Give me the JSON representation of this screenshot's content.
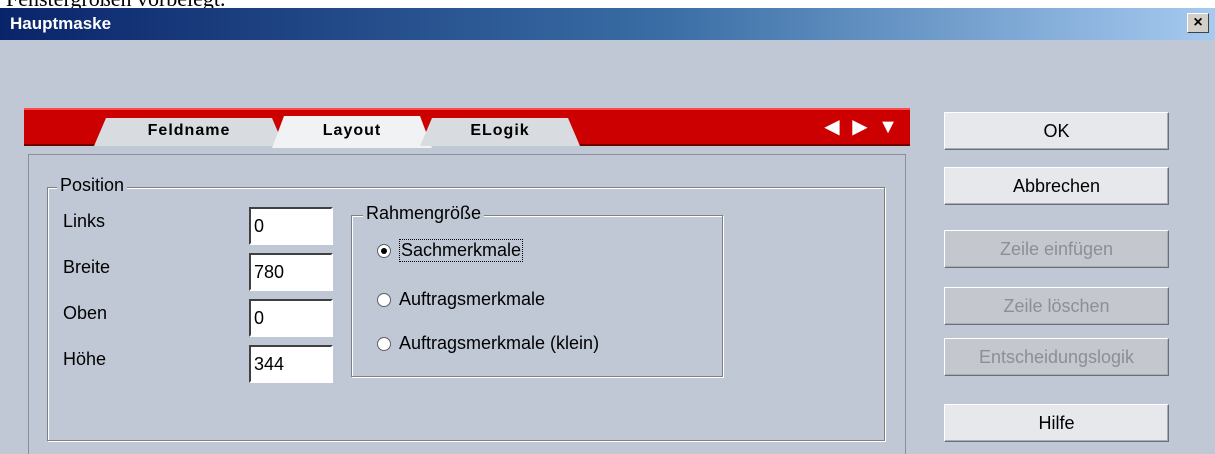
{
  "above_text": "Fenstergrößen vorbelegt.",
  "window": {
    "title": "Hauptmaske",
    "close_glyph": "×"
  },
  "tabs": [
    {
      "label": "Feldname",
      "active": false
    },
    {
      "label": "Layout",
      "active": true
    },
    {
      "label": "ELogik",
      "active": false
    }
  ],
  "nav": {
    "prev": "◀",
    "next": "▶",
    "menu": "▼"
  },
  "position": {
    "group_label": "Position",
    "fields": [
      {
        "label": "Links",
        "value": "0"
      },
      {
        "label": "Breite",
        "value": "780"
      },
      {
        "label": "Oben",
        "value": "0"
      },
      {
        "label": "Höhe",
        "value": "344"
      }
    ]
  },
  "rahmen": {
    "group_label": "Rahmengröße",
    "options": [
      {
        "label": "Sachmerkmale",
        "selected": true
      },
      {
        "label": "Auftragsmerkmale",
        "selected": false
      },
      {
        "label": "Auftragsmerkmale (klein)",
        "selected": false
      }
    ]
  },
  "buttons": {
    "ok": "OK",
    "abbrechen": "Abbrechen",
    "zeile_einfuegen": "Zeile einfügen",
    "zeile_loeschen": "Zeile löschen",
    "entscheidungslogik": "Entscheidungslogik",
    "hilfe": "Hilfe"
  },
  "colors": {
    "tab_bar": "#cc0000",
    "window_bg": "#c0c8d5",
    "titlebar_start": "#0a246a",
    "titlebar_end": "#a6caf0"
  }
}
